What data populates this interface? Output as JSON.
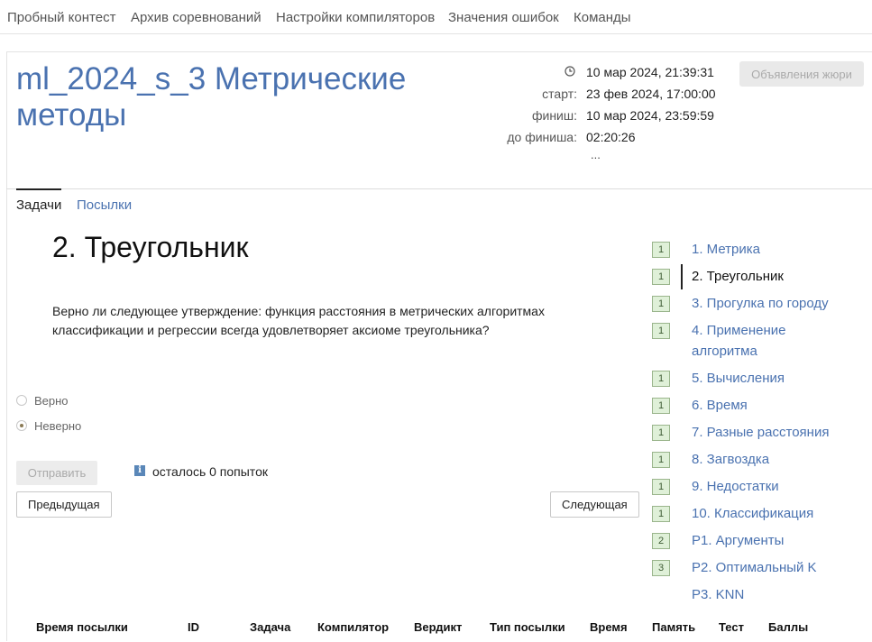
{
  "top_nav": {
    "items": [
      "Пробный контест",
      "Архив соревнований",
      "Настройки компиляторов",
      "Значения ошибок",
      "Команды"
    ]
  },
  "contest": {
    "title": "ml_2024_s_3 Метрические методы",
    "current_time": "10 мар 2024, 21:39:31",
    "start_label": "старт:",
    "start_value": "23 фев 2024, 17:00:00",
    "finish_label": "финиш:",
    "finish_value": "10 мар 2024, 23:59:59",
    "remaining_label": "до финиша:",
    "remaining_value": "02:20:26",
    "more": "...",
    "jury_button": "Объявления жюри",
    "clock_icon": "clock-icon"
  },
  "tabs": [
    "Задачи",
    "Посылки"
  ],
  "problem": {
    "title": "2. Треугольник",
    "statement": "Верно ли следующее утверждение: функция расстояния в метрических алгоритмах классификации и регрессии всегда удовлетворяет аксиоме треугольника?",
    "options": [
      {
        "label": "Верно",
        "checked": false
      },
      {
        "label": "Неверно",
        "checked": true
      }
    ],
    "submit_label": "Отправить",
    "info_icon": "info-icon",
    "attempts_text": "осталось 0 попыток",
    "prev_label": "Предыдущая",
    "next_label": "Следующая"
  },
  "problem_list": [
    {
      "badge": "1",
      "label": "1. Метрика",
      "current": false
    },
    {
      "badge": "1",
      "label": "2. Треугольник",
      "current": true
    },
    {
      "badge": "1",
      "label": "3. Прогулка по городу",
      "current": false
    },
    {
      "badge": "1",
      "label": "4. Применение алгоритма",
      "current": false
    },
    {
      "badge": "1",
      "label": "5. Вычисления",
      "current": false
    },
    {
      "badge": "1",
      "label": "6. Время",
      "current": false
    },
    {
      "badge": "1",
      "label": "7. Разные расстояния",
      "current": false
    },
    {
      "badge": "1",
      "label": "8. Загвоздка",
      "current": false
    },
    {
      "badge": "1",
      "label": "9. Недостатки",
      "current": false
    },
    {
      "badge": "1",
      "label": "10. Классификация",
      "current": false
    },
    {
      "badge": "2",
      "label": "P1. Аргументы",
      "current": false
    },
    {
      "badge": "3",
      "label": "P2. Оптимальный K",
      "current": false
    },
    {
      "badge": "",
      "label": "P3. KNN",
      "current": false
    }
  ],
  "submissions_table": {
    "headers": [
      "Время посылки",
      "ID",
      "Задача",
      "Компилятор",
      "Вердикт",
      "Тип посылки",
      "Время",
      "Память",
      "Тест",
      "Баллы"
    ]
  },
  "colors": {
    "link": "#4a72b0",
    "badge_bg": "#dff0d8",
    "badge_border": "#9ab58c"
  }
}
